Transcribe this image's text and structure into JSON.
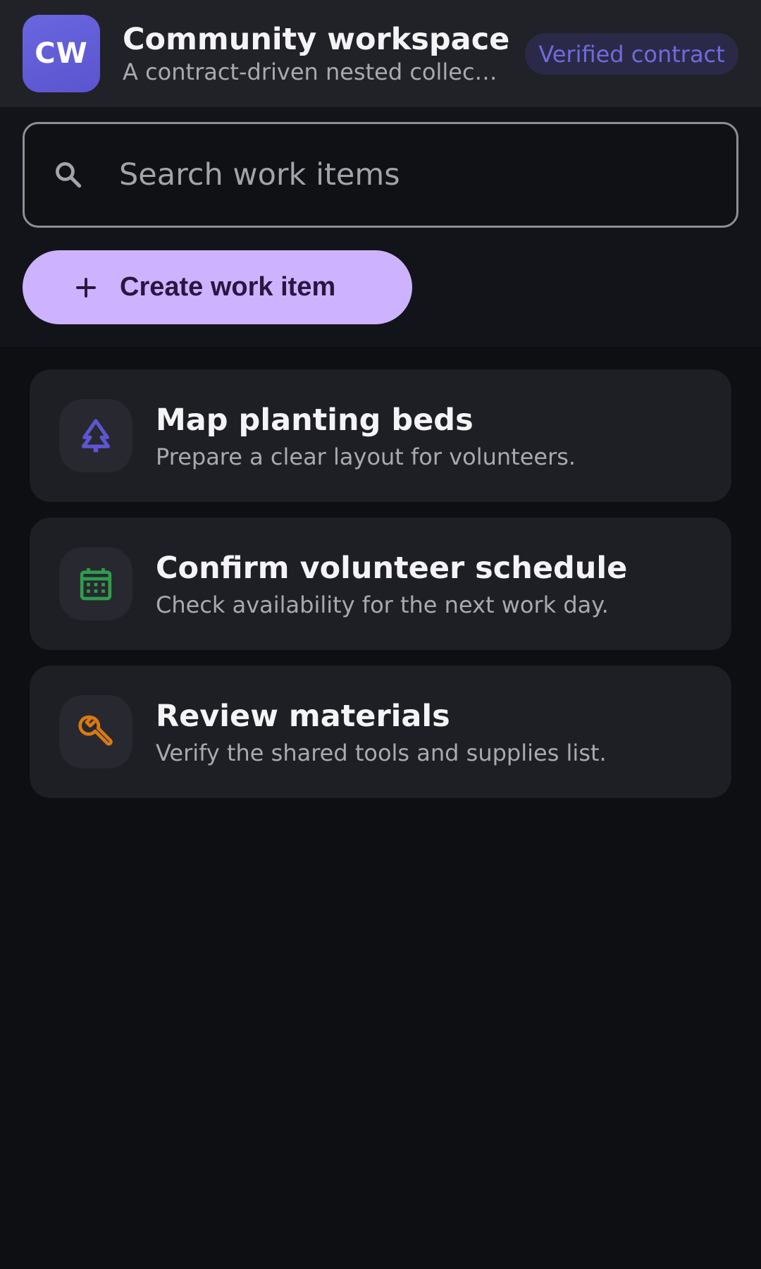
{
  "header": {
    "avatar_initials": "CW",
    "title": "Community workspace",
    "subtitle": "A contract-driven nested collect…",
    "badge": "Verified contract"
  },
  "search": {
    "placeholder": "Search work items",
    "value": "",
    "icon": "search-icon"
  },
  "actions": {
    "create_label": "Create work item",
    "create_icon": "plus-icon"
  },
  "items": [
    {
      "title": "Map planting beds",
      "description": "Prepare a clear layout for volunteers.",
      "icon": "tree-icon",
      "icon_color": "#5b57d1"
    },
    {
      "title": "Confirm volunteer schedule",
      "description": "Check availability for the next work day.",
      "icon": "calendar-icon",
      "icon_color": "#2e9e4a"
    },
    {
      "title": "Review materials",
      "description": "Verify the shared tools and supplies list.",
      "icon": "wrench-icon",
      "icon_color": "#d97a10"
    }
  ],
  "colors": {
    "background": "#0e0f13",
    "app_bar": "#212227",
    "accent": "#cdb3ff",
    "brand": "#6a66e0",
    "card": "#1e1f24"
  }
}
